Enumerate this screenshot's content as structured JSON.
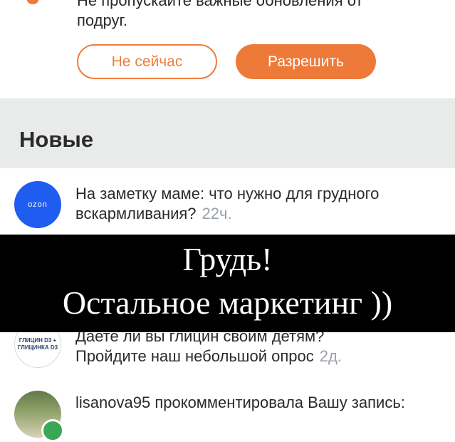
{
  "permission_prompt": {
    "text_top": "Не пропускайте важные обновления от",
    "text_tail": "подруг.",
    "later_label": "Не сейчас",
    "allow_label": "Разрешить"
  },
  "section": {
    "title": "Новые"
  },
  "notifications": [
    {
      "avatar_text": "ozon",
      "text": "На заметку маме: что нужно для грудного вскармливания?",
      "time": "22ч."
    },
    {
      "avatar_line1": "ГЛИЦИН D3 +",
      "avatar_line2": "ГЛИЦИНКА D3",
      "text_line1": "Даете ли вы глицин своим детям?",
      "text_line2": "Пройдите наш небольшой опрос",
      "time": "2д."
    },
    {
      "user": "lisanova95",
      "text": "прокомментировала Вашу запись:"
    }
  ],
  "overlay": {
    "line1": "Грудь!",
    "line2": "Остальное маркетинг ))"
  },
  "colors": {
    "accent": "#ee7a3a",
    "ozon": "#1f5cf0",
    "section_bg": "#e8ebea"
  }
}
